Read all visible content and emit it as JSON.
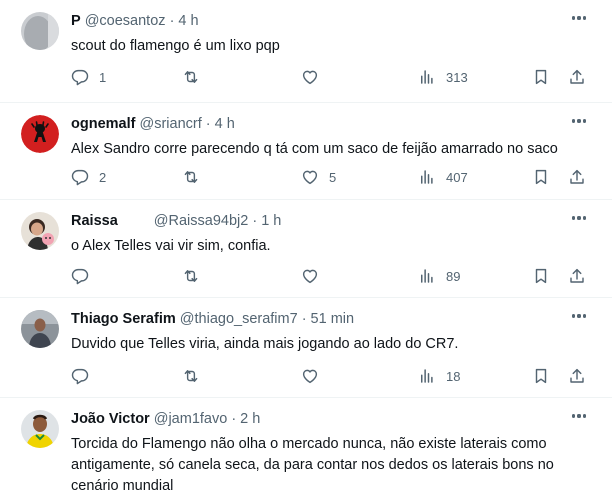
{
  "tweets": [
    {
      "name": "P",
      "handle": "@coesantoz",
      "time": "· 4 h",
      "text": "scout do flamengo é um lixo pqp",
      "replies": "1",
      "retweets": "",
      "likes": "",
      "views": "313"
    },
    {
      "name": "ognemalf",
      "handle": "@sriancrf",
      "time": "· 4 h",
      "text": "Alex Sandro corre parecendo q tá com um saco de feijão amarrado no saco",
      "replies": "2",
      "retweets": "",
      "likes": "5",
      "views": "407"
    },
    {
      "name": "Raissa",
      "handle": "@Raissa94bj2",
      "time": "· 1 h",
      "text": "o Alex Telles vai vir sim, confia.",
      "replies": "",
      "retweets": "",
      "likes": "",
      "views": "89"
    },
    {
      "name": "Thiago Serafim",
      "handle": "@thiago_serafim7",
      "time": "· 51 min",
      "text": "Duvido que Telles viria, ainda mais jogando ao lado do CR7.",
      "replies": "",
      "retweets": "",
      "likes": "",
      "views": "18"
    },
    {
      "name": "João Victor",
      "handle": "@jam1favo",
      "time": "· 2 h",
      "text": "Torcida do Flamengo não olha o mercado nunca, não existe laterais como antigamente, só canela seca, da para contar nos dedos os laterais bons no cenário mundial",
      "replies": "",
      "retweets": "",
      "likes": "",
      "views": ""
    }
  ],
  "icons": {
    "reply": "reply-icon",
    "retweet": "retweet-icon",
    "like": "like-icon",
    "views": "views-icon",
    "bookmark": "bookmark-icon",
    "share": "share-icon",
    "more": "more-icon"
  },
  "colors": {
    "text": "#0f1419",
    "secondary": "#536471",
    "divider": "#eff3f4",
    "flamengo_red": "#d21f1f"
  }
}
